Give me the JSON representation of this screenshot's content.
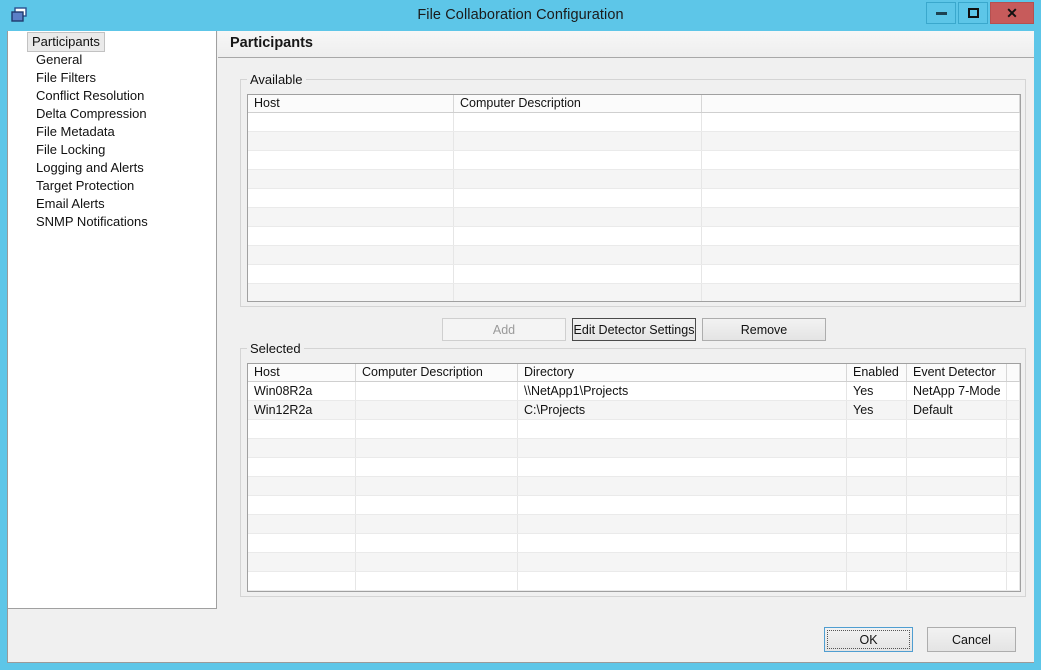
{
  "window": {
    "title": "File Collaboration Configuration",
    "icon": "windows-overlap-icon",
    "accent_color": "#5dc6e8",
    "close_color": "#c75b5b",
    "controls": {
      "minimize": "minimize-icon",
      "maximize": "maximize-icon",
      "close": "✕"
    }
  },
  "sidebar": {
    "items": [
      {
        "label": "Participants",
        "selected": true
      },
      {
        "label": "General",
        "selected": false
      },
      {
        "label": "File Filters",
        "selected": false
      },
      {
        "label": "Conflict Resolution",
        "selected": false
      },
      {
        "label": "Delta Compression",
        "selected": false
      },
      {
        "label": "File Metadata",
        "selected": false
      },
      {
        "label": "File Locking",
        "selected": false
      },
      {
        "label": "Logging and Alerts",
        "selected": false
      },
      {
        "label": "Target Protection",
        "selected": false
      },
      {
        "label": "Email Alerts",
        "selected": false
      },
      {
        "label": "SNMP Notifications",
        "selected": false
      }
    ]
  },
  "pane": {
    "header": "Participants",
    "available": {
      "legend": "Available",
      "columns": [
        "Host",
        "Computer Description",
        ""
      ],
      "rows": []
    },
    "buttons": {
      "add": "Add",
      "add_enabled": false,
      "edit_detector_settings": "Edit Detector Settings",
      "edit_focused": true,
      "remove": "Remove"
    },
    "selected": {
      "legend": "Selected",
      "columns": [
        "Host",
        "Computer Description",
        "Directory",
        "Enabled",
        "Event Detector",
        ""
      ],
      "rows": [
        {
          "host": "Win08R2a",
          "computer_description": "",
          "directory": "\\\\NetApp1\\Projects",
          "enabled": "Yes",
          "event_detector": "NetApp 7-Mode"
        },
        {
          "host": "Win12R2a",
          "computer_description": "",
          "directory": "C:\\Projects",
          "enabled": "Yes",
          "event_detector": "Default"
        }
      ]
    }
  },
  "footer": {
    "ok": "OK",
    "cancel": "Cancel"
  }
}
